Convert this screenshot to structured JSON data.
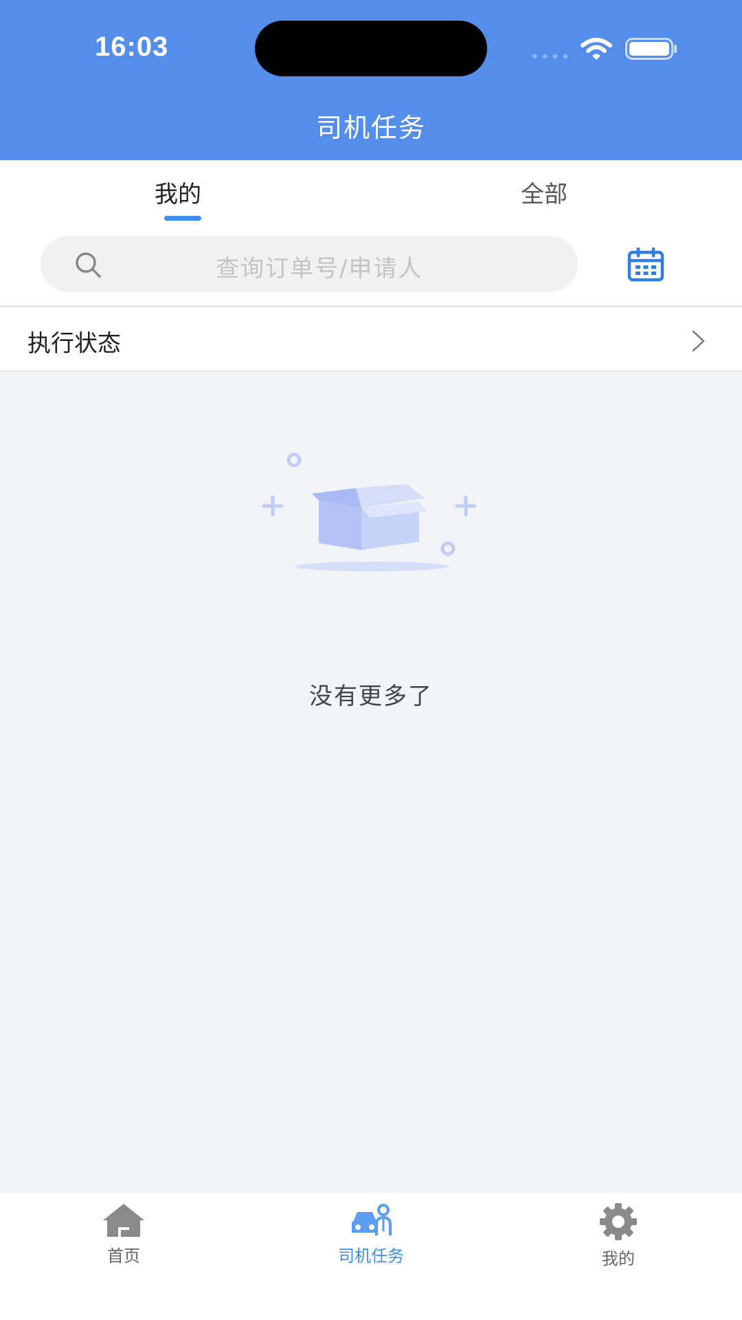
{
  "status_bar": {
    "time": "16:03"
  },
  "header": {
    "title": "司机任务"
  },
  "tabs": [
    {
      "label": "我的",
      "active": true
    },
    {
      "label": "全部",
      "active": false
    }
  ],
  "search": {
    "placeholder": "查询订单号/申请人",
    "icon": "search-icon",
    "calendar_icon": "calendar-icon"
  },
  "filter": {
    "label": "执行状态"
  },
  "empty_state": {
    "message": "没有更多了",
    "icon": "empty-box-icon"
  },
  "bottom_nav": {
    "items": [
      {
        "label": "首页",
        "icon": "home-icon",
        "active": false
      },
      {
        "label": "司机任务",
        "icon": "driver-car-icon",
        "active": true
      },
      {
        "label": "我的",
        "icon": "gear-icon",
        "active": false
      }
    ]
  },
  "colors": {
    "header_bg": "#558deb",
    "accent": "#3b8ff0",
    "page_bg": "#f2f4f8"
  }
}
